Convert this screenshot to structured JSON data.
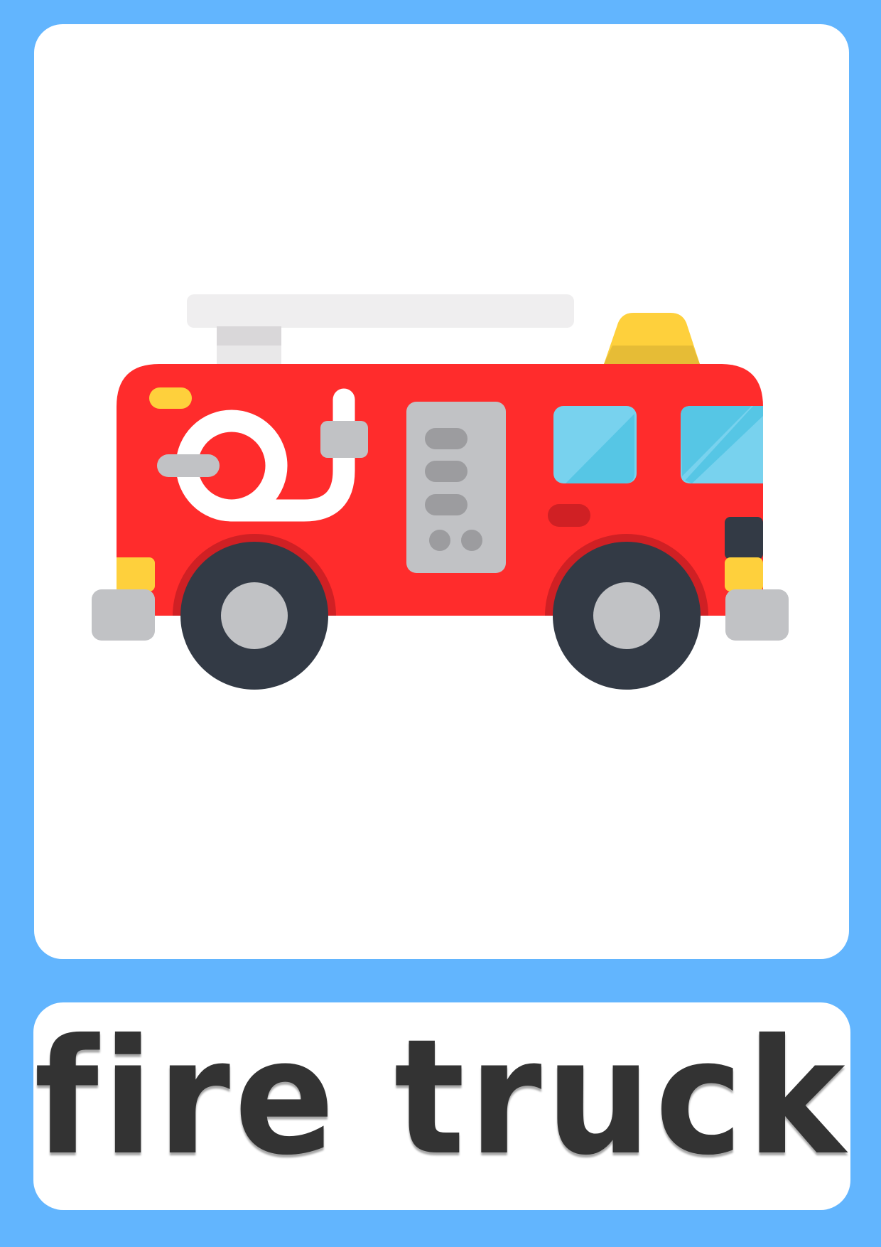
{
  "flashcard": {
    "word": "fire truck",
    "illustration": "fire-truck-icon"
  },
  "colors": {
    "background": "#62b5fe",
    "card": "#ffffff",
    "truck_body": "#ff2c2c",
    "accent_yellow": "#fed03c",
    "window_blue": "#78d2ee",
    "tire": "#333a45",
    "metal_gray": "#c1c2c5",
    "text": "#333333"
  }
}
